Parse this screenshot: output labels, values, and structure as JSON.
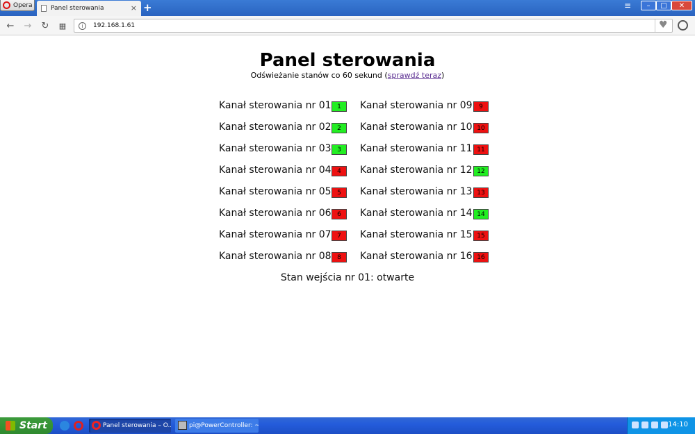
{
  "browser": {
    "menu_label": "Opera",
    "tab_title": "Panel sterowania",
    "tab_close": "×",
    "new_tab": "+",
    "url": "192.168.1.61"
  },
  "page": {
    "title": "Panel sterowania",
    "refresh_prefix": "Odświeżanie stanów co 60 sekund (",
    "refresh_link": "sprawdź teraz",
    "refresh_suffix": ")",
    "input_state": "Stan wejścia nr 01: otwarte"
  },
  "channels": [
    {
      "label": "Kanał sterowania nr 01:",
      "num": "1",
      "on": true
    },
    {
      "label": "Kanał sterowania nr 02:",
      "num": "2",
      "on": true
    },
    {
      "label": "Kanał sterowania nr 03:",
      "num": "3",
      "on": true
    },
    {
      "label": "Kanał sterowania nr 04:",
      "num": "4",
      "on": false
    },
    {
      "label": "Kanał sterowania nr 05:",
      "num": "5",
      "on": false
    },
    {
      "label": "Kanał sterowania nr 06:",
      "num": "6",
      "on": false
    },
    {
      "label": "Kanał sterowania nr 07:",
      "num": "7",
      "on": false
    },
    {
      "label": "Kanał sterowania nr 08:",
      "num": "8",
      "on": false
    },
    {
      "label": "Kanał sterowania nr 09:",
      "num": "9",
      "on": false
    },
    {
      "label": "Kanał sterowania nr 10:",
      "num": "10",
      "on": false
    },
    {
      "label": "Kanał sterowania nr 11:",
      "num": "11",
      "on": false
    },
    {
      "label": "Kanał sterowania nr 12:",
      "num": "12",
      "on": true
    },
    {
      "label": "Kanał sterowania nr 13:",
      "num": "13",
      "on": false
    },
    {
      "label": "Kanał sterowania nr 14:",
      "num": "14",
      "on": true
    },
    {
      "label": "Kanał sterowania nr 15:",
      "num": "15",
      "on": false
    },
    {
      "label": "Kanał sterowania nr 16:",
      "num": "16",
      "on": false
    }
  ],
  "colors": {
    "on": "#22ee22",
    "off": "#ee1111"
  },
  "taskbar": {
    "start_label": "Start",
    "task_opera": "Panel sterowania – O...",
    "task_putty": "pi@PowerController: ~",
    "clock": "14:10"
  }
}
